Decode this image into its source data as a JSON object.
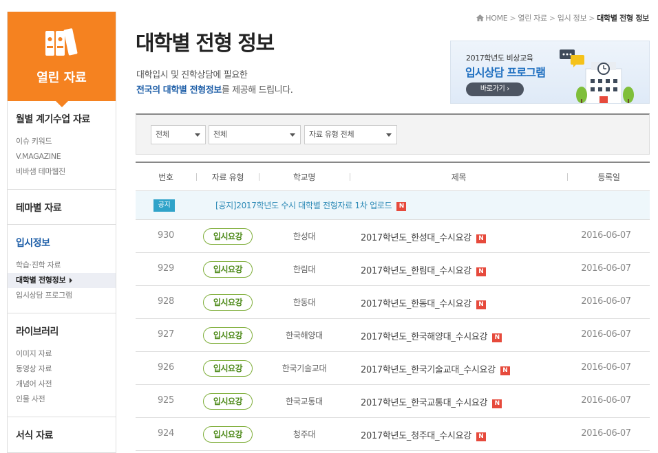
{
  "sidebar": {
    "header": "열린 자료",
    "sections": [
      {
        "title": "월별 계기수업 자료",
        "items": [
          "이슈 키워드",
          "V.MAGAZINE",
          "비바샘 테마웹진"
        ]
      },
      {
        "title": "테마별 자료",
        "items": []
      },
      {
        "title": "입시정보",
        "items": [
          "학습·진학 자료",
          "대학별 전형정보",
          "입시상담 프로그램"
        ]
      },
      {
        "title": "라이브러리",
        "items": [
          "이미지 자료",
          "동영상 자료",
          "개념어 사전",
          "인물 사전"
        ]
      },
      {
        "title": "서식 자료",
        "items": []
      }
    ]
  },
  "breadcrumb": [
    "HOME",
    "열린 자료",
    "입시 정보",
    "대학별 전형 정보"
  ],
  "page": {
    "title": "대학별 전형 정보",
    "desc_line1": "대학입시 및 진학상담에 필요한",
    "desc_highlight": "전국의 대학별 전형정보",
    "desc_line2_rest": "를 제공해 드립니다."
  },
  "banner": {
    "small_text": "2017학년도 비상교육",
    "big_text": "입시상담 프로그램",
    "button": "바로가기 ›"
  },
  "filters": [
    "전체",
    "전체",
    "자료 유형 전체"
  ],
  "table": {
    "headers": [
      "번호",
      "자료 유형",
      "학교명",
      "제목",
      "등록일"
    ],
    "notice": {
      "tag": "공지",
      "title": "[공지]2017학년도 수시 대학별 전형자료 1차 업로드",
      "badge": "N"
    },
    "rows": [
      {
        "num": "930",
        "type": "입시요강",
        "school": "한성대",
        "subject": "2017학년도_한성대_수시요강",
        "badge": "N",
        "date": "2016-06-07"
      },
      {
        "num": "929",
        "type": "입시요강",
        "school": "한림대",
        "subject": "2017학년도_한림대_수시요강",
        "badge": "N",
        "date": "2016-06-07"
      },
      {
        "num": "928",
        "type": "입시요강",
        "school": "한동대",
        "subject": "2017학년도_한동대_수시요강",
        "badge": "N",
        "date": "2016-06-07"
      },
      {
        "num": "927",
        "type": "입시요강",
        "school": "한국해양대",
        "subject": "2017학년도_한국해양대_수시요강",
        "badge": "N",
        "date": "2016-06-07"
      },
      {
        "num": "926",
        "type": "입시요강",
        "school": "한국기술교대",
        "subject": "2017학년도_한국기술교대_수시요강",
        "badge": "N",
        "date": "2016-06-07"
      },
      {
        "num": "925",
        "type": "입시요강",
        "school": "한국교통대",
        "subject": "2017학년도_한국교통대_수시요강",
        "badge": "N",
        "date": "2016-06-07"
      },
      {
        "num": "924",
        "type": "입시요강",
        "school": "청주대",
        "subject": "2017학년도_청주대_수시요강",
        "badge": "N",
        "date": "2016-06-07"
      }
    ]
  },
  "colors": {
    "accent_orange": "#f58220",
    "link_blue": "#1f5fa8",
    "pill_green": "#7fae3a",
    "new_red": "#e64a3c",
    "notice_blue": "#2fa3c9"
  },
  "icons": [
    "binders-icon",
    "home-icon",
    "caret-down-icon",
    "chevron-right-icon",
    "new-icon",
    "speech-bubble-icon",
    "building-icon"
  ]
}
